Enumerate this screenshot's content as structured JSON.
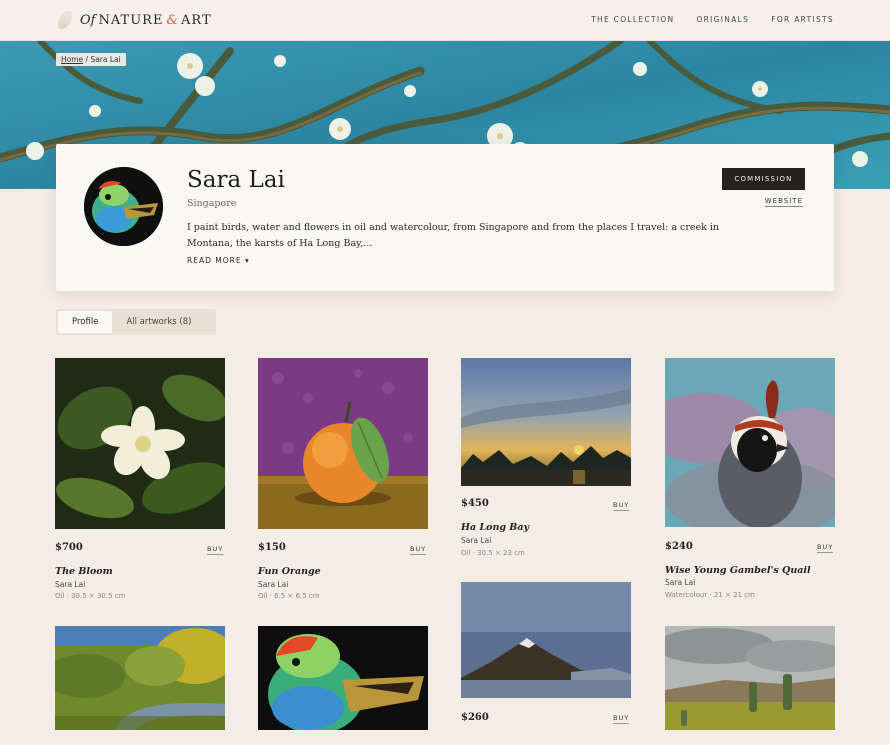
{
  "site": {
    "logo_of": "Of",
    "logo_nature": "NATURE",
    "logo_amp": "&",
    "logo_art": "ART",
    "nav": [
      "THE COLLECTION",
      "ORIGINALS",
      "FOR ARTISTS"
    ]
  },
  "breadcrumb": {
    "home": "Home",
    "separator": " / ",
    "current": "Sara Lai"
  },
  "profile": {
    "name": "Sara Lai",
    "location": "Singapore",
    "bio": "I paint birds, water and flowers in oil and watercolour, from Singapore and from the places I travel: a creek in Montana, the karsts of Ha Long Bay,...",
    "read_more": "READ MORE ▾",
    "commission_label": "COMMISSION",
    "website_label": "WEBSITE"
  },
  "tabs": [
    {
      "label": "Profile",
      "active": true
    },
    {
      "label": "All artworks (8)",
      "active": false
    }
  ],
  "buy_label": "BUY",
  "artworks": [
    {
      "price": "$700",
      "title": "The Bloom",
      "artist": "Sara Lai",
      "meta": "Oil  ·  30.5 × 30.5 cm",
      "image": "white-flower-painting"
    },
    {
      "price": "$150",
      "title": "Fun Orange",
      "artist": "Sara Lai",
      "meta": "Oil  ·  6.5 × 6.5 cm",
      "image": "orange-painting"
    },
    {
      "price": "$450",
      "title": "Ha Long Bay",
      "artist": "Sara Lai",
      "meta": "Oil  ·  30.5 × 23 cm",
      "image": "sunset-bay-painting"
    },
    {
      "price": "$240",
      "title": "Wise Young Gambel's Quail",
      "artist": "Sara Lai",
      "meta": "Watercolour  ·  21 × 21 cm",
      "image": "quail-painting"
    },
    {
      "price": "",
      "title": "",
      "artist": "",
      "meta": "",
      "image": "creek-landscape-painting"
    },
    {
      "price": "",
      "title": "",
      "artist": "",
      "meta": "",
      "image": "green-bird-painting"
    },
    {
      "price": "$260",
      "title": "",
      "artist": "",
      "meta": "",
      "image": "mountain-painting"
    },
    {
      "price": "",
      "title": "",
      "artist": "",
      "meta": "",
      "image": "cactus-landscape-painting"
    }
  ]
}
